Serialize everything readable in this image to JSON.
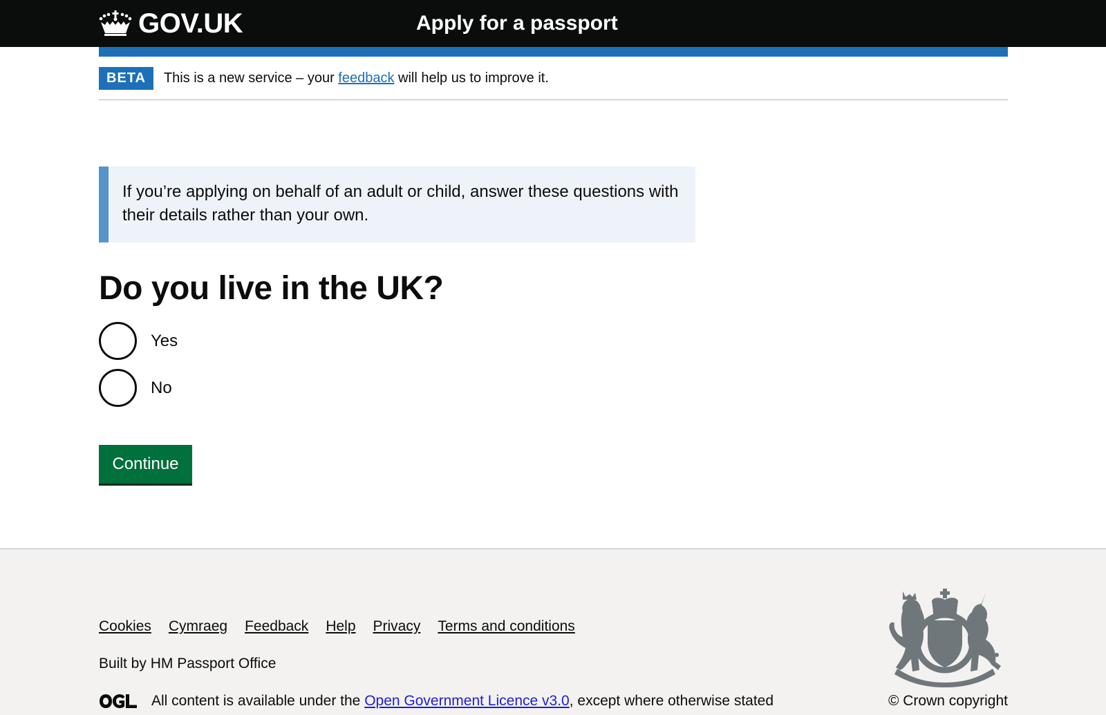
{
  "header": {
    "logo_text": "GOV.UK",
    "service_name": "Apply for a passport",
    "logo_icon": "crown-icon"
  },
  "phase_banner": {
    "tag": "BETA",
    "text_before": "This is a new service – your ",
    "link_text": "feedback",
    "text_after": " will help us to improve it."
  },
  "inset_text": "If you’re applying on behalf of an adult or child, answer these questions with their details rather than your own.",
  "question": {
    "heading": "Do you live in the UK?",
    "options": [
      {
        "label": "Yes",
        "selected": false
      },
      {
        "label": "No",
        "selected": false
      }
    ]
  },
  "continue_button": "Continue",
  "footer": {
    "links": [
      "Cookies",
      "Cymraeg",
      "Feedback",
      "Help",
      "Privacy",
      "Terms and conditions"
    ],
    "built_by": "Built by HM Passport Office",
    "licence_before": "All content is available under the ",
    "licence_link": "Open Government Licence v3.0",
    "licence_after": ", except where otherwise stated",
    "copyright": "© Crown copyright",
    "ogl_icon": "ogl-logo-icon",
    "crest_icon": "royal-coat-of-arms-icon"
  },
  "colors": {
    "header_bg": "#0b0c0c",
    "brand_blue": "#1d70b8",
    "inset_border": "#5694ca",
    "inset_bg": "#eef3f9",
    "button_green": "#00703c",
    "footer_bg": "#f3f2f1"
  }
}
